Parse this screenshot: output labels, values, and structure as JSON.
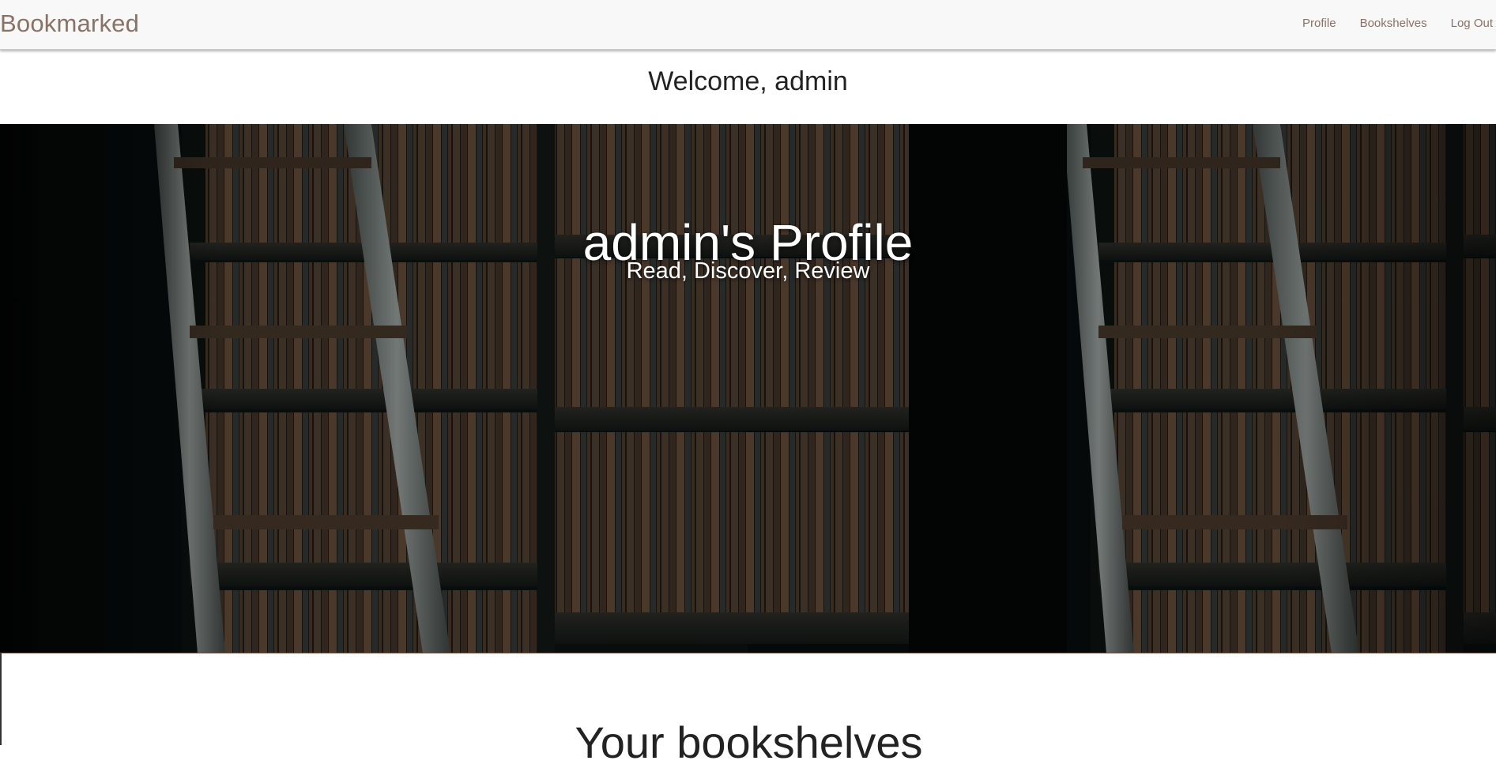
{
  "navbar": {
    "brand": "Bookmarked",
    "links": [
      "Profile",
      "Bookshelves",
      "Log Out"
    ]
  },
  "welcome": {
    "text": "Welcome, admin"
  },
  "hero": {
    "title": "admin's Profile",
    "tagline": "Read, Discover, Review"
  },
  "bookshelves_section": {
    "title": "Your bookshelves"
  },
  "colors": {
    "brand": "#8a7264",
    "navbar_bg": "#f8f8f8",
    "hero_bg": "#070b0b",
    "text_dark": "#222222"
  }
}
